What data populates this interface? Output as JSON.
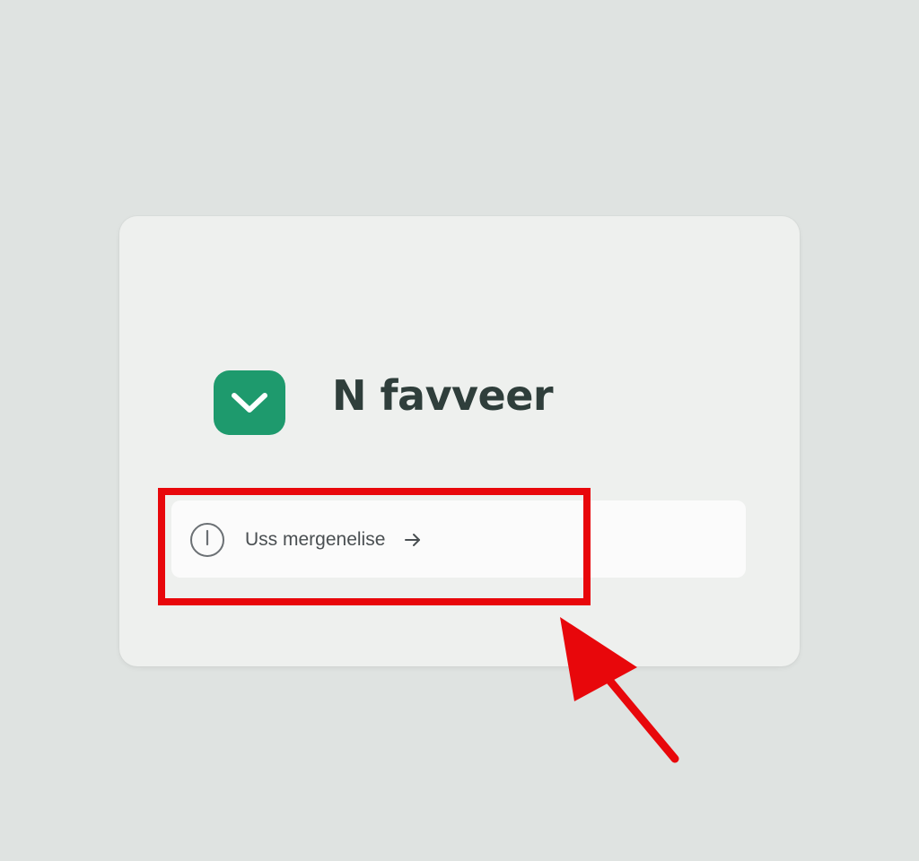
{
  "brand": {
    "title": "N favveer",
    "logo_icon": "chevron-down-icon",
    "logo_color": "#1e9a6d"
  },
  "option": {
    "label": "Uss mergenelise",
    "leading_icon": "info-icon",
    "trailing_icon": "arrow-right-icon"
  },
  "annotation": {
    "highlight_color": "#e8070b",
    "pointer_icon": "red-arrow-icon"
  }
}
